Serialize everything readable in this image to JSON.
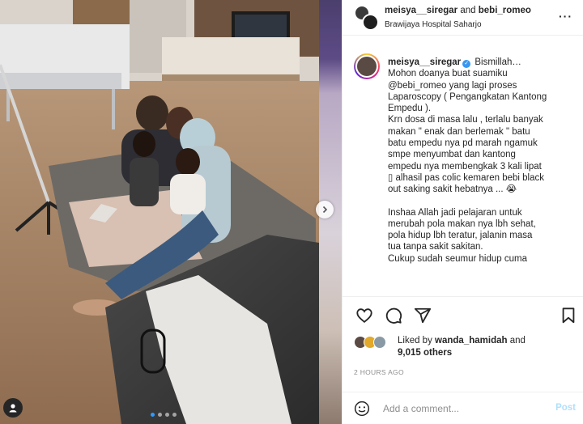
{
  "post": {
    "header": {
      "author": "meisya__siregar",
      "and": "and",
      "collaborator": "bebi_romeo",
      "location": "Brawijaya Hospital Saharjo",
      "more_icon": "more-horizontal-icon"
    },
    "caption": {
      "author": "meisya__siregar",
      "lines": [
        "Bismillah…",
        "Mohon doanya buat suamiku",
        "@bebi_romeo yang lagi proses",
        "Laparoscopy ( Pengangkatan Kantong",
        "Empedu ).",
        "Krn dosa di masa lalu , terlalu banyak",
        "makan \" enak dan berlemak \" batu",
        "batu empedu nya pd marah ngamuk",
        "smpe menyumbat dan kantong",
        "empedu nya membengkak 3 kali lipat",
        "▯ alhasil pas colic kemaren bebi black",
        "out saking sakit hebatnya ... 😭",
        "",
        "Inshaa Allah jadi pelajaran untuk",
        "merubah pola makan nya lbh sehat,",
        "pola hidup lbh teratur, jalanin masa",
        "tua tanpa sakit sakitan.",
        "Cukup sudah seumur hidup cuma"
      ]
    },
    "likes": {
      "prefix": "Liked by",
      "user": "wanda_hamidah",
      "and": "and",
      "count": "9,015 others"
    },
    "time": "2 HOURS AGO",
    "comment": {
      "placeholder": "Add a comment...",
      "post_label": "Post"
    },
    "carousel": {
      "total": 4,
      "active": 1
    }
  },
  "colors": {
    "verified": "#3897f0",
    "link_inactive": "#b2dffc",
    "carousel_active": "#2f9bff",
    "muted": "#8e8e8e"
  }
}
